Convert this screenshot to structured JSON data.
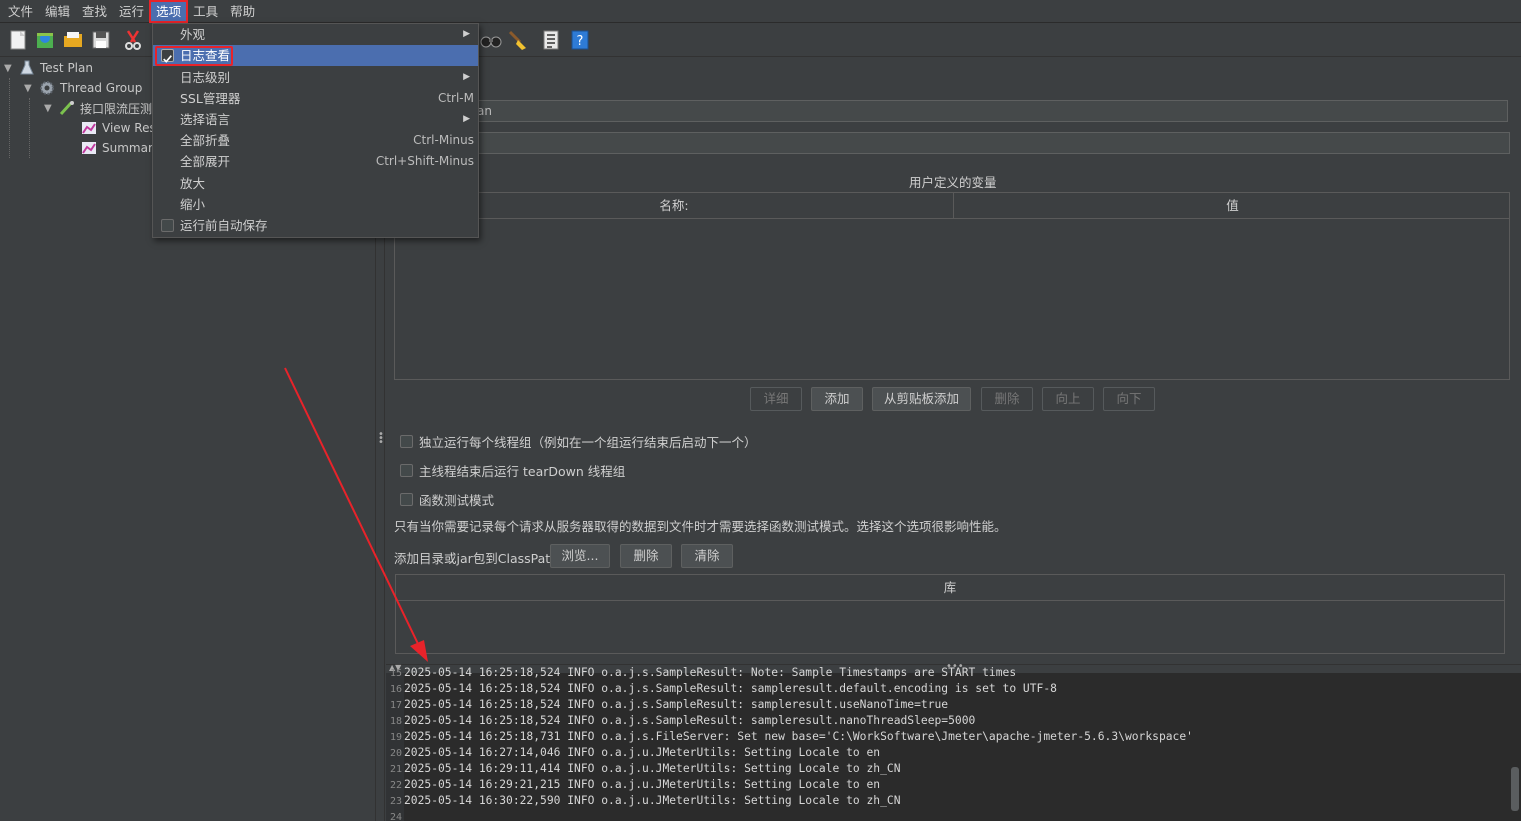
{
  "menubar": {
    "items": [
      "文件",
      "编辑",
      "查找",
      "运行",
      "选项",
      "工具",
      "帮助"
    ],
    "active_index": 4
  },
  "tree": {
    "nodes": [
      {
        "label": "Test Plan"
      },
      {
        "label": "Thread Group"
      },
      {
        "label": "接口限流压测"
      },
      {
        "label": "View Resu"
      },
      {
        "label": "Summary"
      }
    ]
  },
  "options_menu": {
    "items": [
      {
        "label": "外观",
        "accelerator": "",
        "submenu": true
      },
      {
        "label": "日志查看",
        "accelerator": "",
        "checked": true
      },
      {
        "label": "日志级别",
        "accelerator": "",
        "submenu": true
      },
      {
        "label": "SSL管理器",
        "accelerator": "Ctrl-M"
      },
      {
        "label": "选择语言",
        "accelerator": "",
        "submenu": true
      },
      {
        "label": "全部折叠",
        "accelerator": "Ctrl-Minus"
      },
      {
        "label": "全部展开",
        "accelerator": "Ctrl+Shift-Minus"
      },
      {
        "label": "放大",
        "accelerator": ""
      },
      {
        "label": "缩小",
        "accelerator": ""
      },
      {
        "label": "运行前自动保存",
        "accelerator": "",
        "checked": false
      }
    ]
  },
  "right": {
    "name_field_value": "an",
    "comment_field_value": "",
    "variables_title": "用户定义的变量",
    "columns": {
      "name": "名称:",
      "value": "值"
    },
    "buttons": {
      "detail": "详细",
      "add": "添加",
      "add_from_clipboard": "从剪贴板添加",
      "delete": "删除",
      "up": "向上",
      "down": "向下"
    },
    "checkboxes": [
      "独立运行每个线程组（例如在一个组运行结束后启动下一个）",
      "主线程结束后运行 tearDown 线程组",
      "函数测试模式"
    ],
    "note": "只有当你需要记录每个请求从服务器取得的数据到文件时才需要选择函数测试模式。选择这个选项很影响性能。",
    "classpath_label": "添加目录或jar包到ClassPath",
    "classpath_buttons": {
      "browse": "浏览...",
      "delete": "删除",
      "clear": "清除"
    },
    "library_header": "库"
  },
  "log": {
    "lines": [
      {
        "n": "15",
        "text": "2025-05-14 16:25:18,524 INFO o.a.j.s.SampleResult: Note: Sample Timestamps are START times"
      },
      {
        "n": "16",
        "text": "2025-05-14 16:25:18,524 INFO o.a.j.s.SampleResult: sampleresult.default.encoding is set to UTF-8"
      },
      {
        "n": "17",
        "text": "2025-05-14 16:25:18,524 INFO o.a.j.s.SampleResult: sampleresult.useNanoTime=true"
      },
      {
        "n": "18",
        "text": "2025-05-14 16:25:18,524 INFO o.a.j.s.SampleResult: sampleresult.nanoThreadSleep=5000"
      },
      {
        "n": "19",
        "text": "2025-05-14 16:25:18,731 INFO o.a.j.s.FileServer: Set new base='C:\\WorkSoftware\\Jmeter\\apache-jmeter-5.6.3\\workspace'"
      },
      {
        "n": "20",
        "text": "2025-05-14 16:27:14,046 INFO o.a.j.u.JMeterUtils: Setting Locale to en"
      },
      {
        "n": "21",
        "text": "2025-05-14 16:29:11,414 INFO o.a.j.u.JMeterUtils: Setting Locale to zh_CN"
      },
      {
        "n": "22",
        "text": "2025-05-14 16:29:21,215 INFO o.a.j.u.JMeterUtils: Setting Locale to en"
      },
      {
        "n": "23",
        "text": "2025-05-14 16:30:22,590 INFO o.a.j.u.JMeterUtils: Setting Locale to zh_CN"
      },
      {
        "n": "24",
        "text": ""
      }
    ]
  },
  "colors": {
    "accent_highlight": "#4b6eaf",
    "annotation_red": "#e8232a",
    "background": "#3c3f41",
    "log_background": "#2b2b2b"
  }
}
